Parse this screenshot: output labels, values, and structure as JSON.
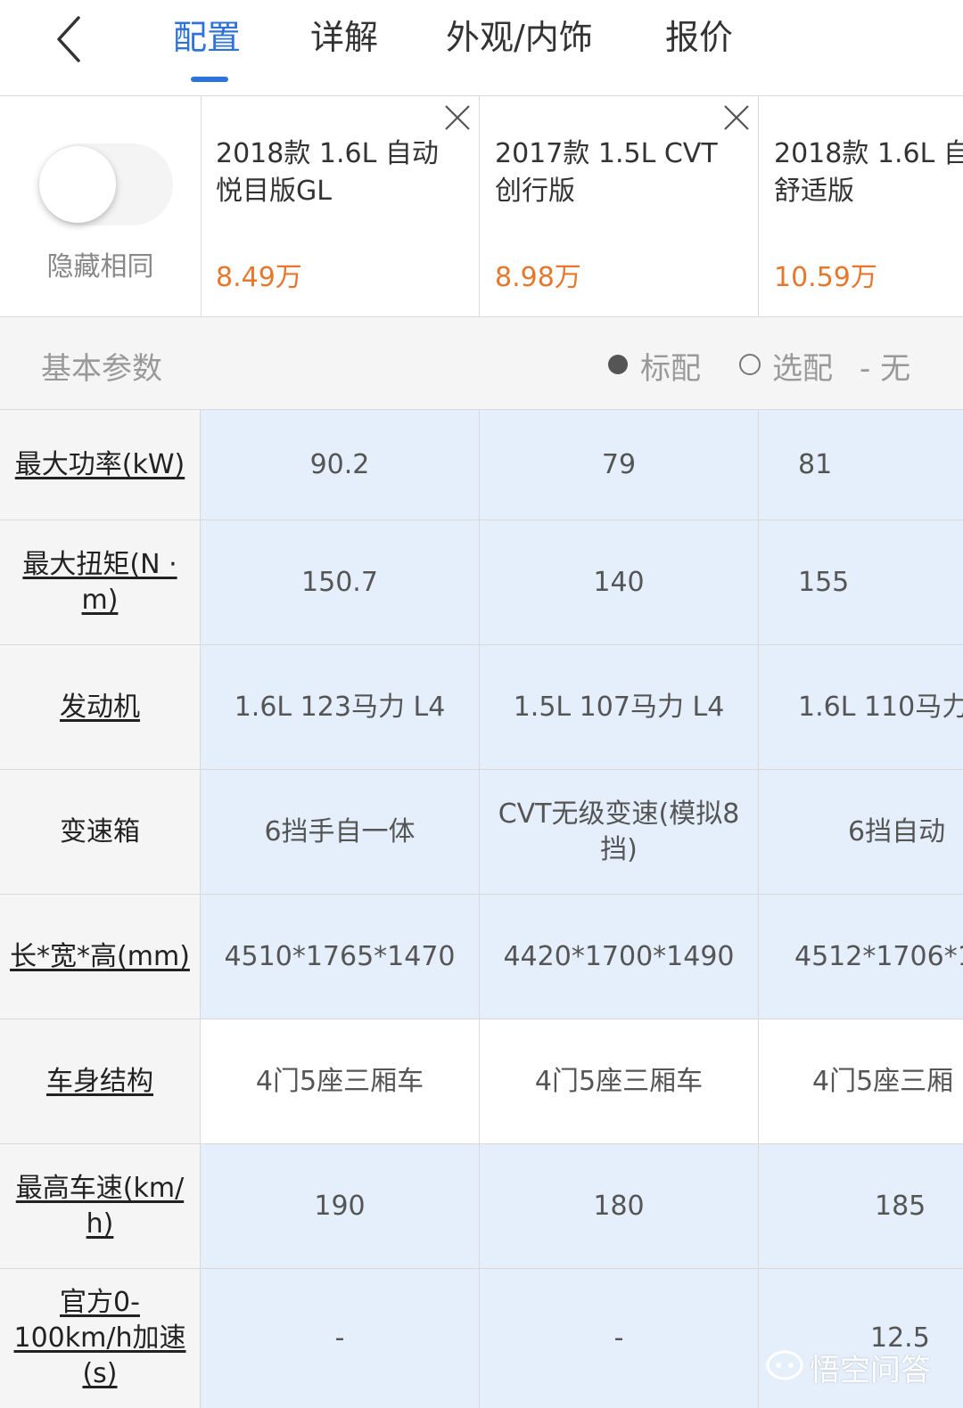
{
  "nav": {
    "tabs": [
      {
        "label": "配置"
      },
      {
        "label": "详解"
      },
      {
        "label": "外观/内饰"
      },
      {
        "label": "报价"
      }
    ],
    "accent_color": "#2f73d9"
  },
  "toggle": {
    "label": "隐藏相同",
    "state": "off"
  },
  "cars": [
    {
      "name_line1": "2018款 1.6L 自动",
      "name_line2": "悦目版GL",
      "price": "8.49万"
    },
    {
      "name_line1": "2017款 1.5L CVT",
      "name_line2": "创行版",
      "price": "8.98万"
    },
    {
      "name_line1": "2018款 1.6L 自",
      "name_line2": "舒适版",
      "price": "10.59万"
    }
  ],
  "price_color": "#e8772e",
  "section": {
    "title": "基本参数",
    "legend_standard": "标配",
    "legend_optional": "选配",
    "legend_none": "- 无"
  },
  "rows": [
    {
      "label": "最大功率(kW)",
      "values": [
        "90.2",
        "79",
        "81"
      ],
      "differs": true
    },
    {
      "label": "最大扭矩(N · m)",
      "values": [
        "150.7",
        "140",
        "155"
      ],
      "differs": true
    },
    {
      "label": "发动机",
      "values": [
        "1.6L 123马力 L4",
        "1.5L 107马力 L4",
        "1.6L 110马力"
      ],
      "differs": true
    },
    {
      "label": "变速箱",
      "values": [
        "6挡手自一体",
        "CVT无级变速(模拟8挡)",
        "6挡自动"
      ],
      "differs": true
    },
    {
      "label": "长*宽*高(mm)",
      "values": [
        "4510*1765*1470",
        "4420*1700*1490",
        "4512*1706*14"
      ],
      "differs": true
    },
    {
      "label": "车身结构",
      "values": [
        "4门5座三厢车",
        "4门5座三厢车",
        "4门5座三厢"
      ],
      "differs": false
    },
    {
      "label": "最高车速(km/h)",
      "values": [
        "190",
        "180",
        "185"
      ],
      "differs": true
    },
    {
      "label": "官方0-100km/h加速(s)",
      "values": [
        "-",
        "-",
        "12.5"
      ],
      "differs": true
    }
  ],
  "watermark": {
    "text": "悟空问答"
  }
}
